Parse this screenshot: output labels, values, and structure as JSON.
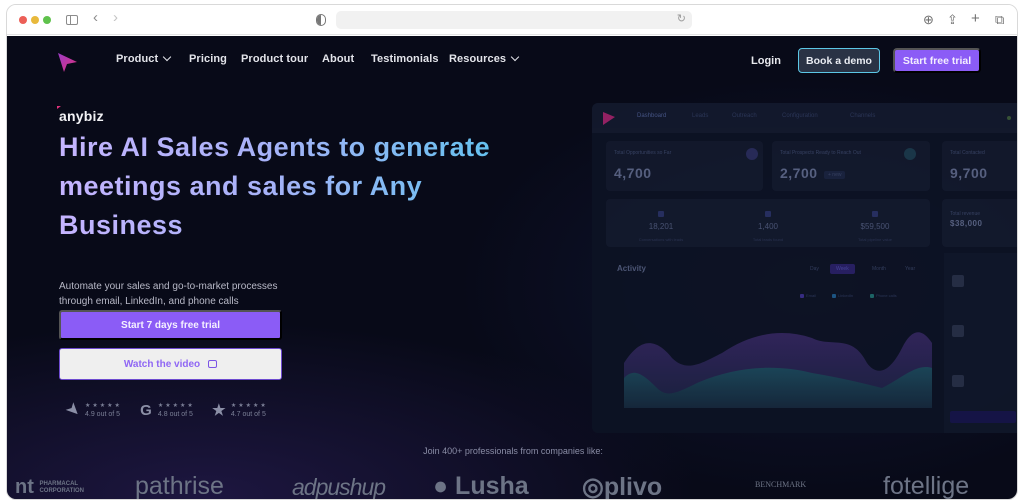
{
  "browser": {
    "nav_back": "‹",
    "nav_forward": "›",
    "reload_icon": "↻",
    "toolbar_icons": [
      "download-icon",
      "share-icon",
      "new-tab-icon",
      "tabs-overview-icon"
    ],
    "toolbar_glyphs": [
      "⊕",
      "⇪",
      "+",
      "⧉"
    ]
  },
  "nav": {
    "items": [
      {
        "label": "Product",
        "dropdown": true
      },
      {
        "label": "Pricing",
        "dropdown": false
      },
      {
        "label": "Product tour",
        "dropdown": false
      },
      {
        "label": "About",
        "dropdown": false
      },
      {
        "label": "Testimonials",
        "dropdown": false
      },
      {
        "label": "Resources",
        "dropdown": true
      }
    ],
    "login": "Login",
    "book_demo": "Book a demo",
    "start_trial": "Start free trial"
  },
  "hero": {
    "brand": "anybiz",
    "headline": "Hire AI Sales Agents to generate meetings and sales for Any Business",
    "subheadline": "Automate your sales and go-to-market processes through email, LinkedIn, and phone calls",
    "cta_primary": "Start 7 days free trial",
    "cta_video": "Watch the video",
    "ratings": [
      {
        "icon": "capterra-icon",
        "glyph": "➤",
        "stars": "★★★★★",
        "score": "4.9 out of 5"
      },
      {
        "icon": "g2-icon",
        "glyph": "G",
        "stars": "★★★★★",
        "score": "4.8 out of 5"
      },
      {
        "icon": "star-icon",
        "glyph": "★",
        "stars": "★★★★★",
        "score": "4.7 out of 5"
      }
    ]
  },
  "dashboard": {
    "tabs": [
      "Dashboard",
      "Leads",
      "Outreach",
      "Configuration",
      "Channels"
    ],
    "cards": [
      {
        "label": "Total Opportunities so Far",
        "value": "4,700"
      },
      {
        "label": "Total Prospects Ready to Reach Out",
        "value": "2,700",
        "badge": "+ new"
      },
      {
        "label": "Total Contacted",
        "value": "9,700"
      }
    ],
    "stats": [
      {
        "value": "18,201",
        "label": "Conversations with leads"
      },
      {
        "value": "1,400",
        "label": "Total leads found"
      },
      {
        "value": "$59,500",
        "label": "Total pipeline value"
      },
      {
        "value": "$38,000",
        "label": "Total revenue"
      }
    ],
    "activity": {
      "title": "Activity",
      "periods": [
        "Day",
        "Week",
        "Month",
        "Year"
      ],
      "active_period": "Week",
      "legend": [
        "Email",
        "LinkedIn",
        "Phone calls"
      ]
    }
  },
  "social_proof": {
    "caption": "Join 400+ professionals from companies like:",
    "logos": [
      "nt PHARMACAL CORPORATION",
      "pathrise",
      "adpushup",
      "Lusha",
      "plivo",
      "BENCHMARK",
      "fotellige"
    ]
  },
  "colors": {
    "accent": "#8b5cf6",
    "background": "#080a18",
    "demo_border": "#5cc7e6"
  }
}
